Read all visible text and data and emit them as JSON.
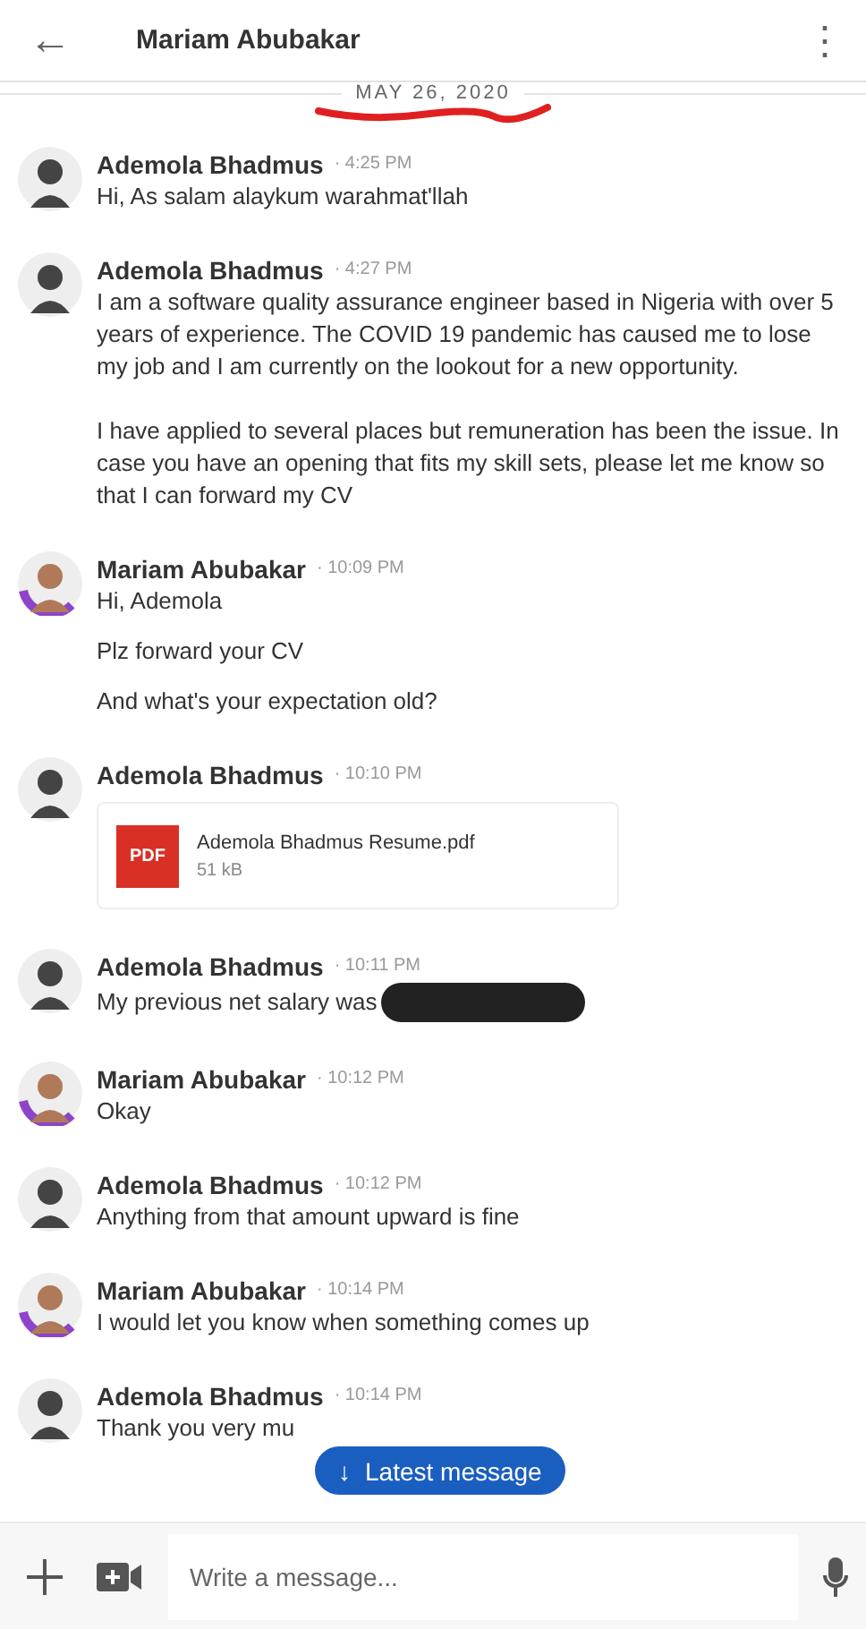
{
  "header": {
    "back": "←",
    "title": "Mariam Abubakar",
    "menu": "⋮"
  },
  "date": {
    "text": "MAY 26, 2020",
    "underlined": true
  },
  "messages": [
    {
      "sender": "Ademola Bhadmus",
      "time": "· 4:25 PM",
      "avatar_ring": false,
      "kind": "text",
      "paragraphs": [
        "Hi, As salam alaykum warahmat'llah"
      ]
    },
    {
      "sender": "Ademola Bhadmus",
      "time": "· 4:27 PM",
      "avatar_ring": false,
      "kind": "text",
      "paragraphs": [
        "I am a software quality assurance engineer based in Nigeria with over 5 years of experience. The COVID 19 pandemic has caused me to lose my job and I am currently on the lookout for a new opportunity.",
        "I have applied to several places but remuneration has been the issue. In case you have an opening that fits my skill sets, please let me know so that I can forward my CV"
      ]
    },
    {
      "sender": "Mariam Abubakar",
      "time": "· 10:09 PM",
      "avatar_ring": true,
      "kind": "text",
      "paragraphs": [
        "Hi, Ademola",
        "Plz forward your CV",
        "And what's your expectation old?"
      ]
    },
    {
      "sender": "Ademola Bhadmus",
      "time": "· 10:10 PM",
      "avatar_ring": false,
      "kind": "file",
      "file": {
        "badge": "PDF",
        "name": "Ademola Bhadmus Resume.pdf",
        "size": "51 kB"
      }
    },
    {
      "sender": "Ademola Bhadmus",
      "time": "· 10:11 PM",
      "avatar_ring": false,
      "kind": "text",
      "paragraphs": [
        "My previous net salary was"
      ],
      "redacted": true
    },
    {
      "sender": "Mariam Abubakar",
      "time": "· 10:12 PM",
      "avatar_ring": true,
      "kind": "text",
      "paragraphs": [
        "Okay"
      ]
    },
    {
      "sender": "Ademola Bhadmus",
      "time": "· 10:12 PM",
      "avatar_ring": false,
      "kind": "text",
      "paragraphs": [
        "Anything from that amount upward is fine"
      ]
    },
    {
      "sender": "Mariam Abubakar",
      "time": "· 10:14 PM",
      "avatar_ring": true,
      "kind": "text",
      "paragraphs": [
        "I would let you know when something comes up"
      ]
    },
    {
      "sender": "Ademola Bhadmus",
      "time": "· 10:14 PM",
      "avatar_ring": false,
      "kind": "text",
      "paragraphs": [
        "Thank you very mu"
      ]
    }
  ],
  "latest_button": {
    "arrow": "↓",
    "label": "Latest message"
  },
  "composer": {
    "placeholder": "Write a message..."
  }
}
